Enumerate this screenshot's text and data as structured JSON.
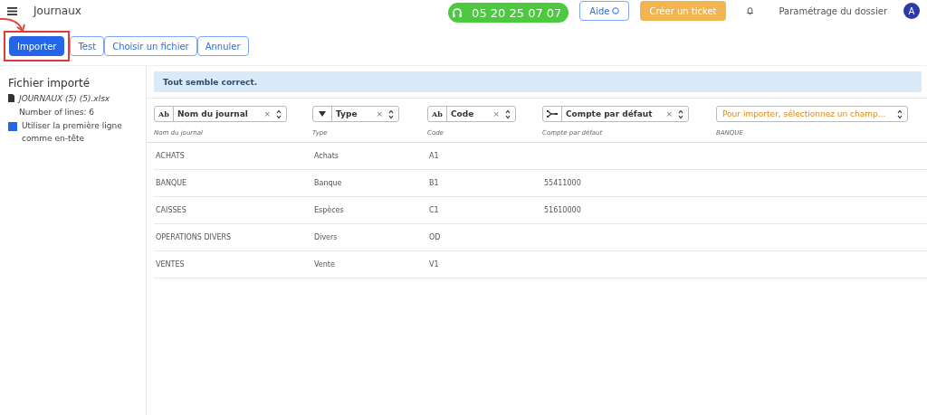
{
  "header": {
    "title": "Journaux",
    "phone": "05 20 25 07 07",
    "help": "Aide",
    "ticket": "Créer un ticket",
    "settings": "Paramétrage du dossier",
    "avatar": "A"
  },
  "toolbar": [
    {
      "label": "Importer",
      "primary": true,
      "highlighted": true
    },
    {
      "label": "Test",
      "primary": false,
      "highlighted": false
    },
    {
      "label": "Choisir un fichier",
      "primary": false,
      "highlighted": false
    },
    {
      "label": "Annuler",
      "primary": false,
      "highlighted": false
    }
  ],
  "sidebar": {
    "title": "Fichier importé",
    "file": "JOURNAUX (5) (5).xlsx",
    "lines": "Number of lines: 6",
    "header_option": {
      "label": "Utiliser la première ligne comme en-tête",
      "checked": true
    }
  },
  "alert": "Tout semble correct.",
  "mappings": [
    {
      "kind": "text",
      "icon": "Ab",
      "value": "Nom du journal",
      "clear": "×",
      "column": "Nom du journal"
    },
    {
      "kind": "selection",
      "value": "Type",
      "clear": "×",
      "column": "Type"
    },
    {
      "kind": "text",
      "icon": "Ab",
      "value": "Code",
      "clear": "×",
      "column": "Code"
    },
    {
      "kind": "relation",
      "value": "Compte par défaut",
      "clear": "×",
      "column": "Compte par défaut"
    },
    {
      "kind": "empty",
      "placeholder": "Pour importer, sélectionnez un champ...",
      "column": "BANQUE"
    }
  ],
  "rows": [
    [
      "ACHATS",
      "Achats",
      "A1",
      ""
    ],
    [
      "BANQUE",
      "Banque",
      "B1",
      "55411000"
    ],
    [
      "CAISSES",
      "Espèces",
      "C1",
      "51610000"
    ],
    [
      "OPERATIONS DIVERS",
      "Divers",
      "OD",
      ""
    ],
    [
      "VENTES",
      "Vente",
      "V1",
      ""
    ]
  ]
}
